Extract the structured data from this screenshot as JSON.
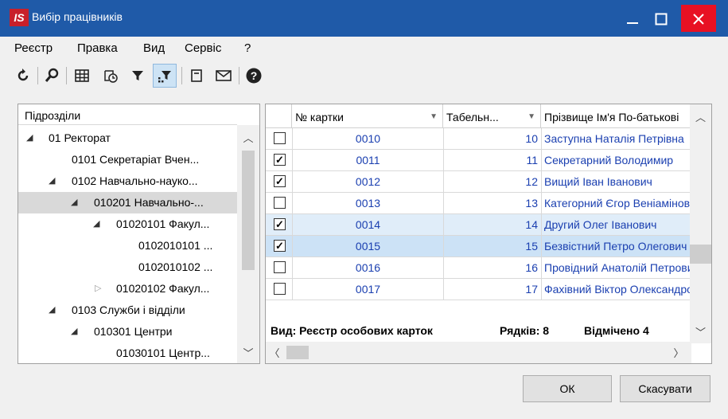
{
  "window": {
    "title": "Вибір працівників",
    "logo": "IS"
  },
  "menu": [
    "Реєстр",
    "Правка",
    "Вид",
    "Сервіс",
    "?"
  ],
  "toolbar": [
    "refresh-icon",
    "search-icon",
    "table-icon",
    "history-icon",
    "filter-icon",
    "filter-active-icon",
    "form-icon",
    "mail-icon",
    "help-icon"
  ],
  "tree": {
    "header": "Підрозділи",
    "rows": [
      {
        "label": "01 Ректорат"
      },
      {
        "label": "0101 Секретаріат Вчен..."
      },
      {
        "label": "0102 Навчально-науко..."
      },
      {
        "label": "010201 Навчально-..."
      },
      {
        "label": "01020101 Факул..."
      },
      {
        "label": "0102010101 ..."
      },
      {
        "label": "0102010102 ..."
      },
      {
        "label": "01020102 Факул..."
      },
      {
        "label": "0103 Служби і відділи"
      },
      {
        "label": "010301 Центри"
      },
      {
        "label": "01030101 Центр..."
      }
    ]
  },
  "grid": {
    "columns": {
      "card": "№ картки",
      "tab": "Табельн...",
      "name": "Прізвище Ім'я По-батькові"
    },
    "rows": [
      {
        "checked": false,
        "card": "0010",
        "tab": "10",
        "name": "Заступна Наталія Петрівна"
      },
      {
        "checked": true,
        "card": "0011",
        "tab": "11",
        "name": "Секретарний Володимир"
      },
      {
        "checked": true,
        "card": "0012",
        "tab": "12",
        "name": "Вищий Іван Іванович"
      },
      {
        "checked": false,
        "card": "0013",
        "tab": "13",
        "name": "Категорний Єгор Веніамінович"
      },
      {
        "checked": true,
        "card": "0014",
        "tab": "14",
        "name": "Другий Олег Іванович"
      },
      {
        "checked": true,
        "card": "0015",
        "tab": "15",
        "name": "Безвістний Петро Олегович"
      },
      {
        "checked": false,
        "card": "0016",
        "tab": "16",
        "name": "Провідний Анатолій Петрович"
      },
      {
        "checked": false,
        "card": "0017",
        "tab": "17",
        "name": "Фахівний Віктор Олександрович"
      }
    ],
    "status": {
      "view": "Вид: Реєстр особових карток",
      "rows": "Рядків: 8",
      "marked": "Відмічено 4"
    }
  },
  "buttons": {
    "ok": "ОК",
    "cancel": "Скасувати"
  },
  "colors": {
    "titlebar": "#1f5aa8",
    "close": "#e81123",
    "link": "#1a3fb0",
    "row_highlight": "#e0edf9"
  }
}
